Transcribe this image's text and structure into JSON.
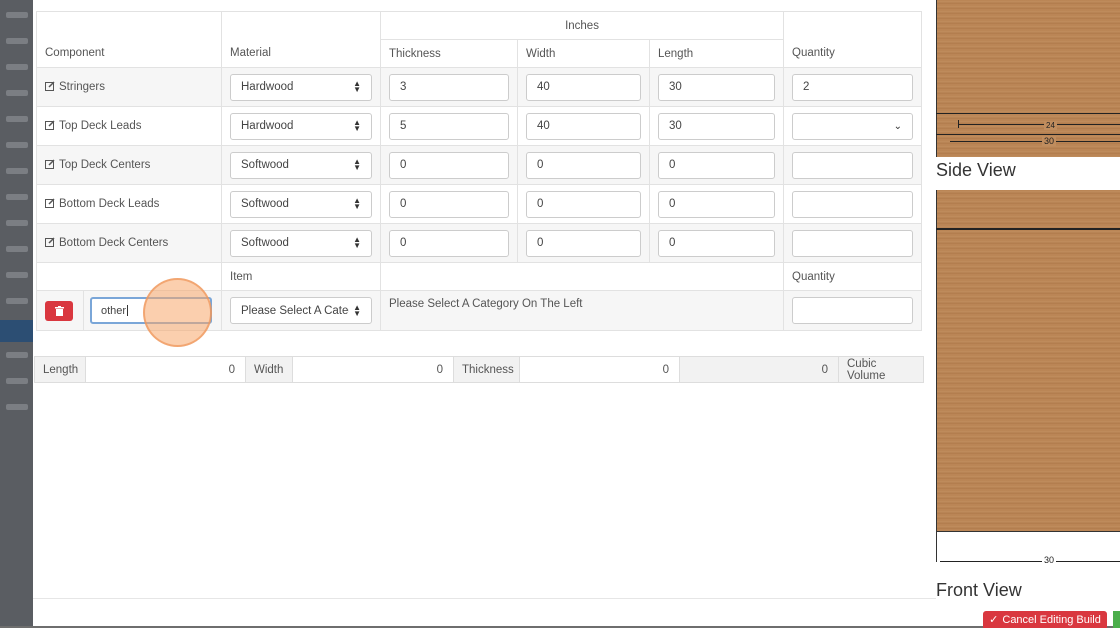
{
  "table": {
    "header_group": "Inches",
    "columns": [
      "Component",
      "Material",
      "Thickness",
      "Width",
      "Length",
      "Quantity"
    ],
    "rows": [
      {
        "component": "Stringers",
        "material": "Hardwood",
        "thickness": "3",
        "width": "40",
        "length": "30",
        "quantity": "2",
        "quantity_type": "input"
      },
      {
        "component": "Top Deck Leads",
        "material": "Hardwood",
        "thickness": "5",
        "width": "40",
        "length": "30",
        "quantity": "",
        "quantity_type": "select"
      },
      {
        "component": "Top Deck Centers",
        "material": "Softwood",
        "thickness": "0",
        "width": "0",
        "length": "0",
        "quantity": "",
        "quantity_type": "input"
      },
      {
        "component": "Bottom Deck Leads",
        "material": "Softwood",
        "thickness": "0",
        "width": "0",
        "length": "0",
        "quantity": "",
        "quantity_type": "input"
      },
      {
        "component": "Bottom Deck Centers",
        "material": "Softwood",
        "thickness": "0",
        "width": "0",
        "length": "0",
        "quantity": "",
        "quantity_type": "input"
      }
    ],
    "sub_header": {
      "item": "Item",
      "quantity": "Quantity"
    },
    "other_row": {
      "name_value": "other",
      "category_select": "Please Select A Category",
      "item_placeholder": "Please Select A Category On The Left",
      "quantity": ""
    }
  },
  "dims": {
    "length_label": "Length",
    "length_value": "0",
    "width_label": "Width",
    "width_value": "0",
    "thickness_label": "Thickness",
    "thickness_value": "0",
    "volume_value": "0",
    "volume_label": "Cubic Volume"
  },
  "preview": {
    "side_label": "Side View",
    "front_label": "Front View",
    "dim_top": "30",
    "dim_small": "24",
    "dim_bottom": "30"
  },
  "buttons": {
    "cancel": "Cancel Editing Build"
  },
  "colors": {
    "danger": "#d9373f",
    "success": "#4cae4c",
    "wood": "#b98453"
  }
}
